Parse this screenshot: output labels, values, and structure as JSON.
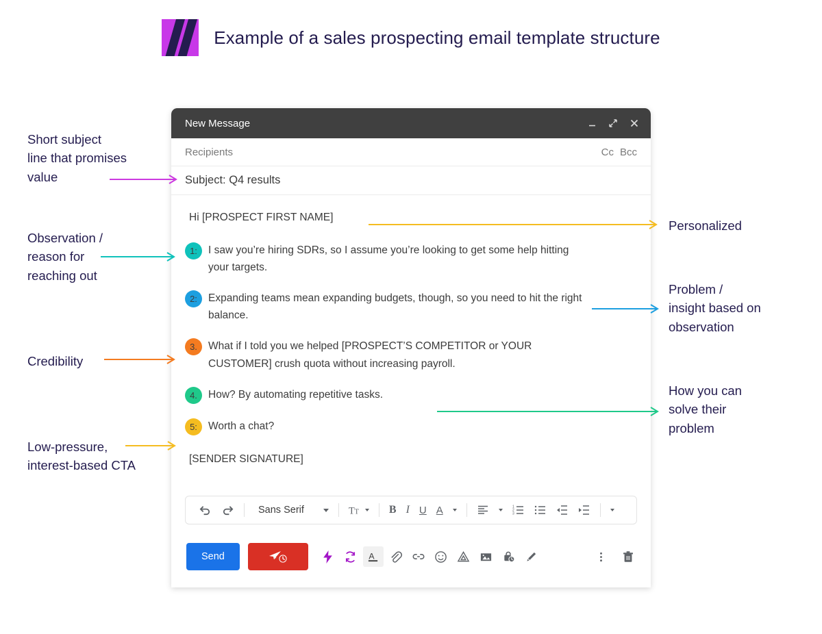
{
  "header": {
    "title": "Example of a sales prospecting email template structure",
    "logo_colors": {
      "background": "#c838e8",
      "slash": "#241c4f"
    }
  },
  "mail": {
    "window_title": "New Message",
    "window_buttons": [
      {
        "name": "minimize",
        "glyph": "–"
      },
      {
        "name": "expand",
        "glyph": "↗"
      },
      {
        "name": "close",
        "glyph": "×"
      }
    ],
    "recipients_label": "Recipients",
    "cc_label": "Cc",
    "bcc_label": "Bcc",
    "subject": "Subject: Q4 results",
    "greeting": "Hi [PROSPECT FIRST NAME]",
    "signature": "[SENDER SIGNATURE]",
    "bullets": [
      {
        "num": "1:",
        "color": "#0fc2bb",
        "text": "I saw you’re hiring SDRs, so I assume you’re looking to get some help hitting your targets."
      },
      {
        "num": "2:",
        "color": "#1d9fe0",
        "text": "Expanding teams mean expanding budgets, though, so you need to hit the right balance."
      },
      {
        "num": "3.",
        "color": "#f47b20",
        "text": "What if I told you we helped [PROSPECT’S COMPETITOR or YOUR CUSTOMER] crush quota without increasing payroll."
      },
      {
        "num": "4.",
        "color": "#1fc98a",
        "text": "How? By automating repetitive tasks."
      },
      {
        "num": "5:",
        "color": "#f5bc20",
        "text": "Worth a chat?"
      }
    ],
    "toolbar": {
      "undo": "undo-icon",
      "redo": "redo-icon",
      "font_name": "Sans Serif",
      "font_size": "Tt",
      "bold": "B",
      "italic": "I",
      "underline": "U",
      "text_color": "A",
      "align": "align-icon",
      "numbered_list": "numbered-list-icon",
      "bulleted_list": "bulleted-list-icon",
      "indent_less": "indent-less-icon",
      "indent_more": "indent-more-icon",
      "more": "more-formatting-icon"
    },
    "actions": {
      "send_label": "Send",
      "schedule_send": "schedule-send-icon",
      "icons": [
        "lightning-icon",
        "sync-icon",
        "text-color-icon",
        "attach-icon",
        "link-icon",
        "emoji-icon",
        "drive-icon",
        "image-icon",
        "confidential-mode-icon",
        "signature-icon"
      ],
      "more_options": "more-options-icon",
      "discard": "trash-icon",
      "send_color": "#1a73e8",
      "schedule_color": "#d93025"
    }
  },
  "annotations": {
    "left": [
      {
        "id": "subject-note",
        "lines": [
          "Short subject",
          "line that promises",
          "value"
        ],
        "arrow_color": "#cc3ae0"
      },
      {
        "id": "observation-note",
        "lines": [
          "Observation /",
          "reason for",
          "reaching out"
        ],
        "arrow_color": "#0fc2bb"
      },
      {
        "id": "credibility-note",
        "lines": [
          "Credibility"
        ],
        "arrow_color": "#f47b20"
      },
      {
        "id": "cta-note",
        "lines": [
          "Low-pressure,",
          "interest-based CTA"
        ],
        "arrow_color": "#f5bc20"
      }
    ],
    "right": [
      {
        "id": "personalized-note",
        "lines": [
          "Personalized"
        ],
        "arrow_color": "#f5bc20"
      },
      {
        "id": "problem-note",
        "lines": [
          "Problem /",
          "insight based on",
          "observation"
        ],
        "arrow_color": "#1d9fe0"
      },
      {
        "id": "solution-note",
        "lines": [
          "How you can",
          "solve their",
          "problem"
        ],
        "arrow_color": "#1fc98a"
      }
    ]
  }
}
